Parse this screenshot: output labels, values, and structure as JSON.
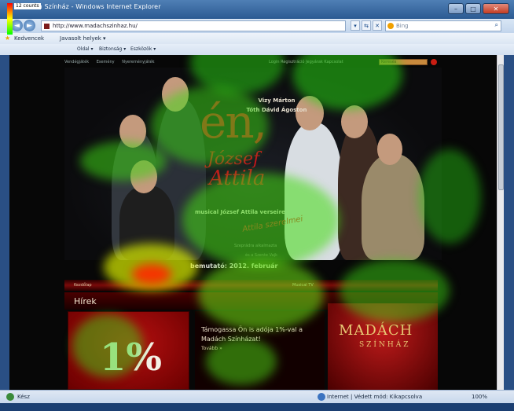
{
  "window": {
    "title": "Madách Színház - Windows Internet Explorer",
    "min": "–",
    "max": "□",
    "close": "✕"
  },
  "heatmap_legend": {
    "label": "12 counts"
  },
  "address": {
    "url": "http://www.madachszinhaz.hu/",
    "search_placeholder": "Bing",
    "search_go": "⌕",
    "back": "◄",
    "forward": "►",
    "icons": [
      "▾",
      "⇆",
      "✕"
    ]
  },
  "favorites": {
    "label": "Kedvencek",
    "suggested": "Javasolt helyek ▾"
  },
  "command_bar": {
    "items": [
      "Oldal ▾",
      "Biztonság ▾",
      "Eszközök ▾"
    ]
  },
  "page": {
    "top_menu": [
      "Vendégjáték",
      "Esemény",
      "Nyereményjáték"
    ],
    "top_right": "Login  Regisztráció   Jegyárak   Kapcsolat",
    "search_label": "Keresés",
    "actors": [
      "Vizy Márton",
      "Tóth Dávid Ágoston"
    ],
    "title_en": "én,",
    "title_jozsef": "József",
    "title_attila": "Attila",
    "subtitle": "musical József Attila verseire",
    "szerelmei": "Attila szerelmei",
    "credit_1": "Szeprádra alkalmazta",
    "credit_2": "és a Szente Vajk",
    "premiere": "bemutató: 2012. február",
    "nav_items": [
      "Kezdőlap",
      "Musical TV"
    ],
    "news_heading": "Hírek",
    "percent": "1%",
    "news_text": "Támogassa Ön is adója 1%-val a Madách Színházat!",
    "news_more": "Tovább »",
    "logo_line1": "MADÁCH",
    "logo_line2": "SZÍNHÁZ"
  },
  "status": {
    "ready": "Kész",
    "zone": "Internet | Védett mód: Kikapcsolva",
    "zoom": "100%"
  },
  "colors": {
    "title_red": "#c4151c",
    "page_bg": "#070707",
    "ie_blue": "#2b5a92"
  }
}
